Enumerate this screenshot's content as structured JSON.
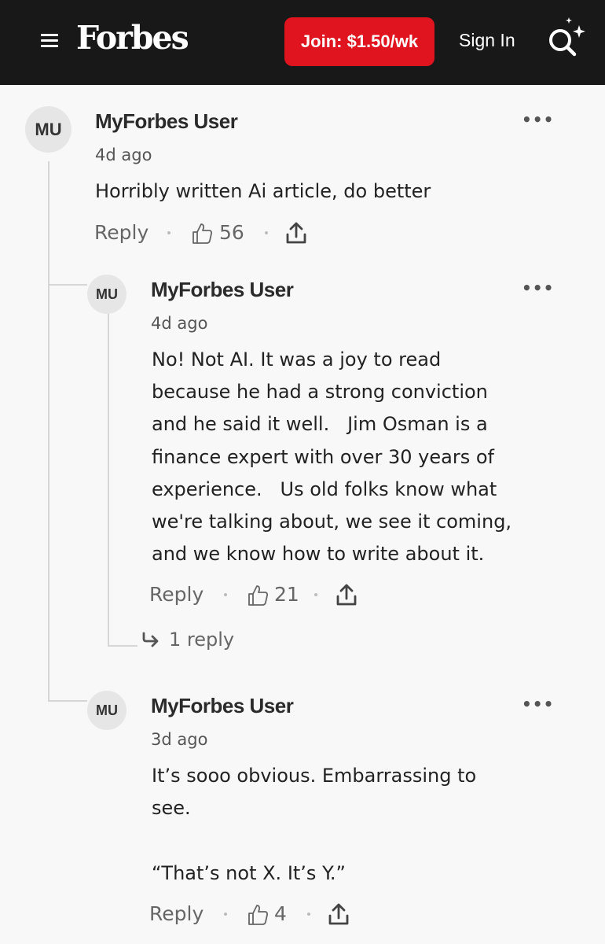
{
  "header": {
    "logo": "Forbes",
    "join_label": "Join: $1.50/wk",
    "sign_in_label": "Sign In"
  },
  "comments": [
    {
      "initials": "MU",
      "author": "MyForbes User",
      "time": "4d ago",
      "text": "Horribly written Ai article, do better",
      "reply_label": "Reply",
      "likes": "56"
    },
    {
      "initials": "MU",
      "author": "MyForbes User",
      "time": "4d ago",
      "text": "No! Not AI. It was a joy to read\nbecause he had a strong conviction\nand he said it well.   Jim Osman is a\nfinance expert with over 30 years of\nexperience.   Us old folks know what\nwe're talking about, we see it coming,\nand we know how to write about it.",
      "reply_label": "Reply",
      "likes": "21",
      "replies_label": "1 reply"
    },
    {
      "initials": "MU",
      "author": "MyForbes User",
      "time": "3d ago",
      "text": "It’s sooo obvious. Embarrassing to\nsee.\n\n“That’s not X. It’s Y.”",
      "reply_label": "Reply",
      "likes": "4"
    }
  ]
}
